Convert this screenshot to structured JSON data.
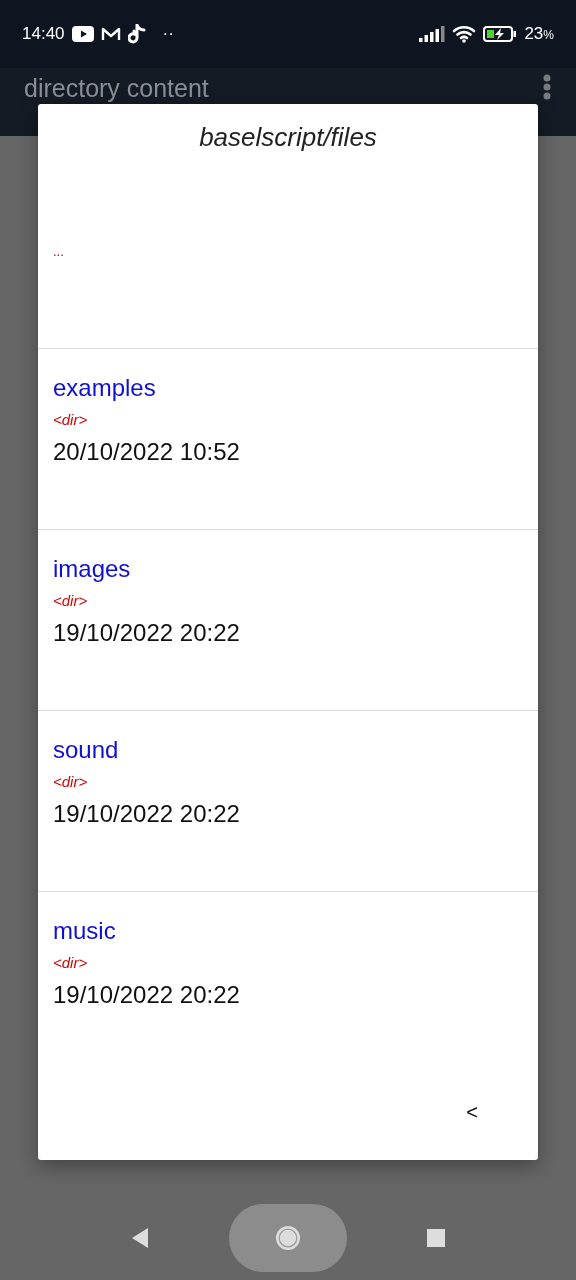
{
  "status_bar": {
    "time": "14:40",
    "more": "··",
    "battery": "23%"
  },
  "app_bar": {
    "title": "directory content"
  },
  "dialog": {
    "title": "baselscript/files",
    "entries": [
      {
        "kind": "parent",
        "label": "..."
      },
      {
        "kind": "dir",
        "name": "examples",
        "type": "<dir>",
        "date": "20/10/2022 10:52"
      },
      {
        "kind": "dir",
        "name": "images",
        "type": "<dir>",
        "date": "19/10/2022 20:22"
      },
      {
        "kind": "dir",
        "name": "sound",
        "type": "<dir>",
        "date": "19/10/2022 20:22"
      },
      {
        "kind": "dir",
        "name": "music",
        "type": "<dir>",
        "date": "19/10/2022 20:22"
      }
    ],
    "back_button": "<"
  }
}
